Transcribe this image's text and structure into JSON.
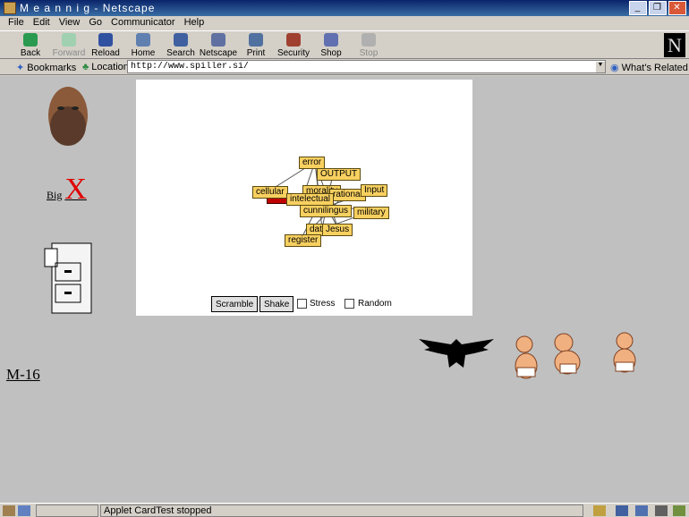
{
  "window": {
    "title": "M e a n n i g - Netscape"
  },
  "menu": [
    "File",
    "Edit",
    "View",
    "Go",
    "Communicator",
    "Help"
  ],
  "toolbar": [
    {
      "label": "Back",
      "icon": "back-arrow-icon",
      "enabled": true,
      "color": "#2a9a50"
    },
    {
      "label": "Forward",
      "icon": "forward-arrow-icon",
      "enabled": false,
      "color": "#a0d0b0"
    },
    {
      "label": "Reload",
      "icon": "reload-icon",
      "enabled": true,
      "color": "#3050a0"
    },
    {
      "label": "Home",
      "icon": "home-icon",
      "enabled": true,
      "color": "#6080b0"
    },
    {
      "label": "Search",
      "icon": "search-icon",
      "enabled": true,
      "color": "#4060a0"
    },
    {
      "label": "Netscape",
      "icon": "netscape-icon",
      "enabled": true,
      "color": "#6070a0"
    },
    {
      "label": "Print",
      "icon": "print-icon",
      "enabled": true,
      "color": "#5070a0"
    },
    {
      "label": "Security",
      "icon": "lock-icon",
      "enabled": true,
      "color": "#a04030"
    },
    {
      "label": "Shop",
      "icon": "shop-icon",
      "enabled": true,
      "color": "#6070b0"
    },
    {
      "label": "Stop",
      "icon": "stop-icon",
      "enabled": false,
      "color": "#b0b0b0"
    }
  ],
  "location": {
    "bookmarks_label": "Bookmarks",
    "location_label": "Location:",
    "url": "http://www.spiller.si/",
    "whats_related": "What's Related"
  },
  "page": {
    "big_link": "Big",
    "big_x": "X",
    "m16_link": "M-16",
    "applet": {
      "nodes": [
        "error",
        "OUTPUT",
        "cellular",
        "morality",
        "rational",
        "Input",
        "intelectual",
        "cunnilingus",
        "military",
        "data",
        "Jesus",
        "register"
      ],
      "buttons": [
        "Scramble",
        "Shake"
      ],
      "checkboxes": [
        {
          "label": "Stress",
          "checked": false
        },
        {
          "label": "Random",
          "checked": false
        }
      ]
    }
  },
  "status": {
    "message": "Applet CardTest stopped"
  }
}
